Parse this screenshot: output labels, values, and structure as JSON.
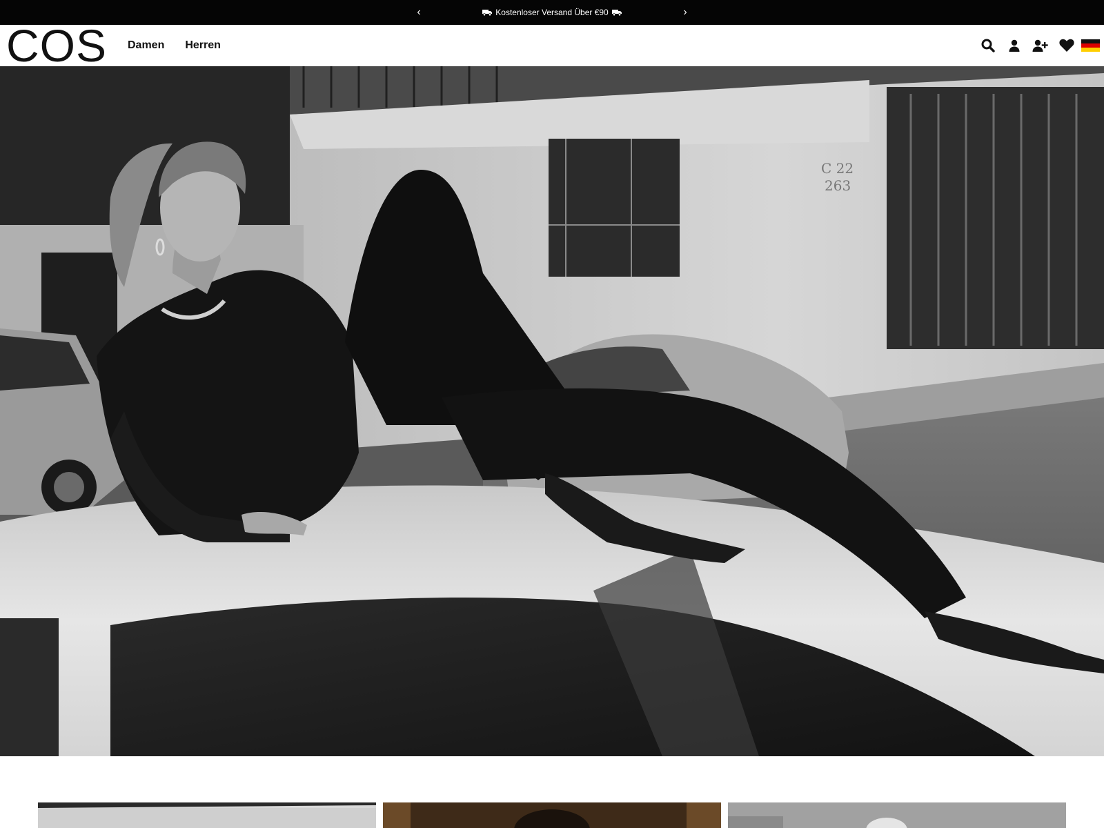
{
  "announcement": {
    "prev_label": "‹",
    "next_label": "›",
    "message": "Kostenloser Versand Über €90",
    "icon": "truck-icon"
  },
  "header": {
    "logo": "COS",
    "nav": [
      {
        "label": "Damen"
      },
      {
        "label": "Herren"
      }
    ],
    "icons": [
      "search-icon",
      "account-icon",
      "register-icon",
      "wishlist-icon",
      "germany-flag-icon"
    ]
  },
  "hero": {
    "image": "black-and-white photo of woman in black outfit reclining on a white car roof",
    "wall_sign": "C 22 263"
  },
  "tiles": [
    {
      "image": "grey tile image"
    },
    {
      "image": "portrait tile image"
    },
    {
      "image": "greyscale landscape tile image"
    }
  ],
  "colors": {
    "announcement_bg": "#050505",
    "text": "#111111",
    "background": "#ffffff"
  }
}
